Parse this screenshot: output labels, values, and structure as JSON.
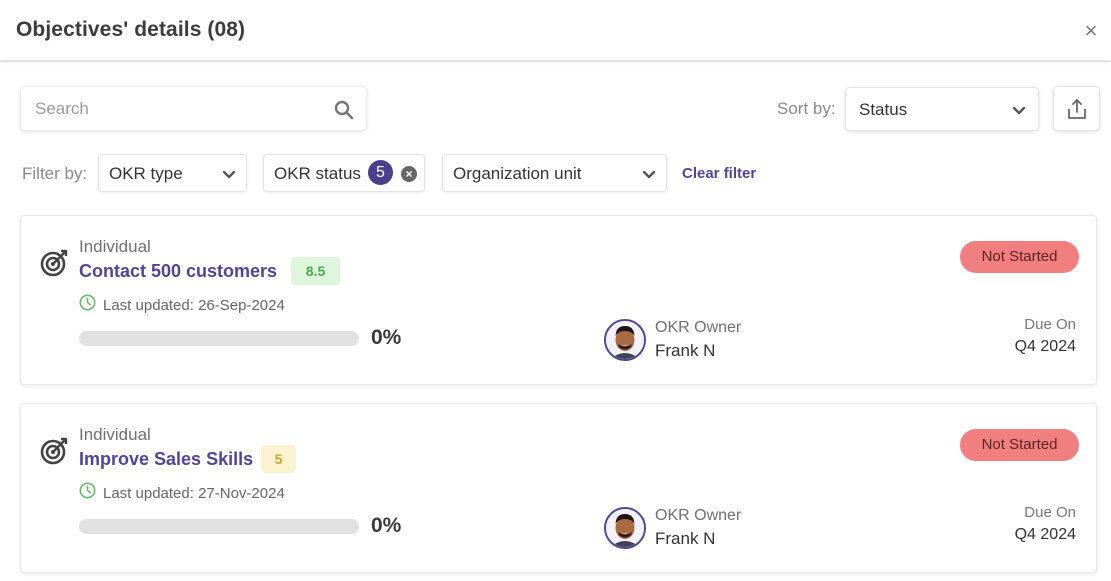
{
  "header": {
    "title": "Objectives' details (08)",
    "close_symbol": "×"
  },
  "search": {
    "placeholder": "Search",
    "value": ""
  },
  "sort": {
    "label": "Sort by:",
    "selected": "Status"
  },
  "filters": {
    "label": "Filter by:",
    "okr_type": "OKR type",
    "okr_status": "OKR status",
    "okr_status_count": "5",
    "org_unit": "Organization unit",
    "clear": "Clear filter"
  },
  "objectives": [
    {
      "type": "Individual",
      "name": "Contact 500 customers",
      "score": "8.5",
      "score_color": "#dff6dc",
      "updated": "Last updated: 26-Sep-2024",
      "progress": "0%",
      "progress_value": 0,
      "owner_label": "OKR Owner",
      "owner_name": "Frank N",
      "status": "Not Started",
      "due_label": "Due On",
      "due": "Q4 2024"
    },
    {
      "type": "Individual",
      "name": "Improve Sales Skills",
      "score": "5",
      "score_color": "#fbf3cf",
      "updated": "Last updated: 27-Nov-2024",
      "progress": "0%",
      "progress_value": 0,
      "owner_label": "OKR Owner",
      "owner_name": "Frank N",
      "status": "Not Started",
      "due_label": "Due On",
      "due": "Q4 2024"
    }
  ],
  "icons": {
    "search": "search-icon",
    "sort_chevron": "chevron-down-icon",
    "export": "export-icon",
    "objective": "target-icon",
    "clock": "clock-icon",
    "close": "close-icon"
  },
  "colors": {
    "accent": "#4e4699",
    "status_not_started": "#f27f7f"
  }
}
